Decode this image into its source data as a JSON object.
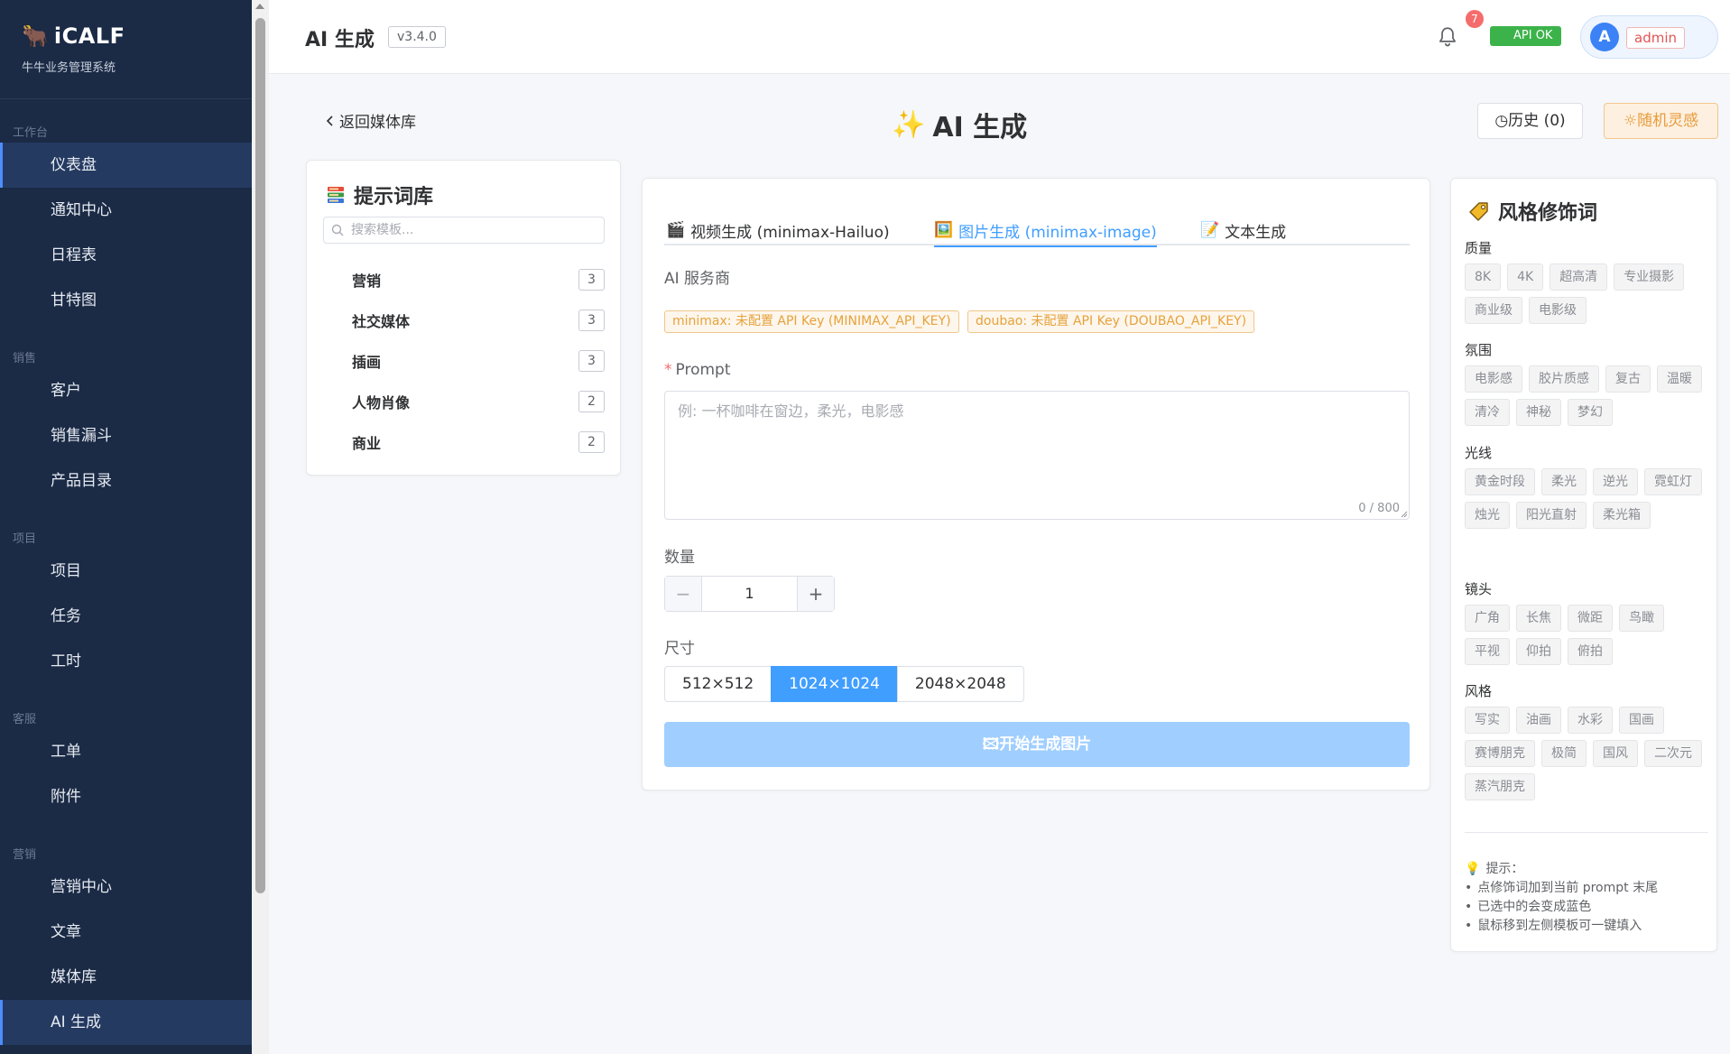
{
  "brand": {
    "logo": "🐂",
    "name": "iCALF",
    "subtitle": "牛牛业务管理系统"
  },
  "sidebar": {
    "groups": [
      {
        "title": "工作台",
        "items": [
          "仪表盘",
          "通知中心",
          "日程表",
          "甘特图"
        ]
      },
      {
        "title": "销售",
        "items": [
          "客户",
          "销售漏斗",
          "产品目录"
        ]
      },
      {
        "title": "项目",
        "items": [
          "项目",
          "任务",
          "工时"
        ]
      },
      {
        "title": "客服",
        "items": [
          "工单",
          "附件"
        ]
      },
      {
        "title": "营销",
        "items": [
          "营销中心",
          "文章",
          "媒体库",
          "AI 生成"
        ]
      }
    ],
    "active_items": [
      "仪表盘",
      "AI 生成"
    ]
  },
  "header": {
    "title": "AI 生成",
    "version": "v3.4.0",
    "notification_count": "7",
    "api_status": "API OK",
    "avatar_letter": "A",
    "user_role": "admin"
  },
  "toolbar": {
    "back_label": "返回媒体库",
    "center_title": "AI 生成",
    "center_icon": "✨",
    "history_label": "历史 (0)",
    "inspire_label": "随机灵感"
  },
  "prompt_library": {
    "title": "提示词库",
    "search_placeholder": "搜索模板...",
    "categories": [
      {
        "name": "营销",
        "count": "3"
      },
      {
        "name": "社交媒体",
        "count": "3"
      },
      {
        "name": "插画",
        "count": "3"
      },
      {
        "name": "人物肖像",
        "count": "2"
      },
      {
        "name": "商业",
        "count": "2"
      }
    ]
  },
  "generator": {
    "tabs": [
      {
        "icon": "🎬",
        "label": "视频生成 (minimax-Hailuo)"
      },
      {
        "icon": "🖼️",
        "label": "图片生成 (minimax-image)"
      },
      {
        "icon": "📝",
        "label": "文本生成"
      }
    ],
    "active_tab": 1,
    "provider_label": "AI 服务商",
    "warnings": [
      "minimax: 未配置 API Key (MINIMAX_API_KEY)",
      "doubao: 未配置 API Key (DOUBAO_API_KEY)"
    ],
    "prompt_label": "Prompt",
    "prompt_placeholder": "例: 一杯咖啡在窗边，柔光，电影感",
    "prompt_value": "",
    "char_count": "0 / 800",
    "quantity_label": "数量",
    "quantity_value": "1",
    "size_label": "尺寸",
    "sizes": [
      "512×512",
      "1024×1024",
      "2048×2048"
    ],
    "active_size": 1,
    "generate_label": "开始生成图片"
  },
  "modifiers": {
    "title": "风格修饰词",
    "sections": [
      {
        "label": "质量",
        "chips": [
          "8K",
          "4K",
          "超高清",
          "专业摄影",
          "商业级",
          "电影级"
        ]
      },
      {
        "label": "氛围",
        "chips": [
          "电影感",
          "胶片质感",
          "复古",
          "温暖",
          "清冷",
          "神秘",
          "梦幻"
        ]
      },
      {
        "label": "光线",
        "chips": [
          "黄金时段",
          "柔光",
          "逆光",
          "霓虹灯",
          "烛光",
          "阳光直射",
          "柔光箱"
        ]
      },
      {
        "label": "镜头",
        "chips": [
          "广角",
          "长焦",
          "微距",
          "鸟瞰",
          "平视",
          "仰拍",
          "俯拍"
        ]
      },
      {
        "label": "风格",
        "chips": [
          "写实",
          "油画",
          "水彩",
          "国画",
          "赛博朋克",
          "极简",
          "国风",
          "二次元",
          "蒸汽朋克"
        ]
      }
    ],
    "tips_title": "提示：",
    "tips": [
      "点修饰词加到当前 prompt 末尾",
      "已选中的会变成蓝色",
      "鼠标移到左侧模板可一键填入"
    ]
  },
  "colors": {
    "sidebar_bg": "#1b2a45",
    "accent": "#409eff",
    "warning": "#e6a23c",
    "success": "#3cb34a",
    "danger": "#f56c6c"
  }
}
